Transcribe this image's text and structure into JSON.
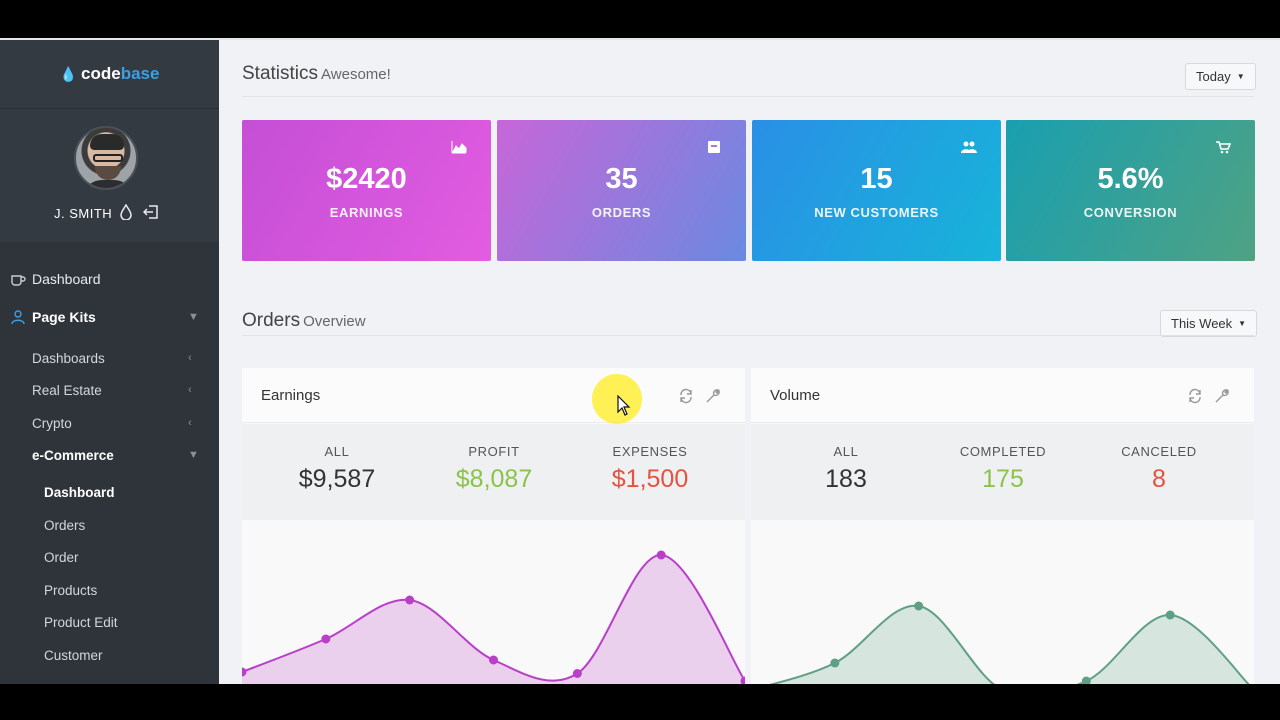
{
  "brand": {
    "part1": "code",
    "part2": "base"
  },
  "user": {
    "name": "J. SMITH"
  },
  "nav": {
    "dashboard": "Dashboard",
    "page_kits": "Page Kits",
    "dashboards": "Dashboards",
    "real_estate": "Real Estate",
    "crypto": "Crypto",
    "ecommerce": "e-Commerce",
    "ec_items": [
      "Dashboard",
      "Orders",
      "Order",
      "Products",
      "Product Edit",
      "Customer"
    ]
  },
  "statistics": {
    "title": "Statistics",
    "subtitle": "Awesome!",
    "range": "Today",
    "cards": [
      {
        "value": "$2420",
        "label": "EARNINGS",
        "icon": "area-chart-icon"
      },
      {
        "value": "35",
        "label": "ORDERS",
        "icon": "inbox-icon"
      },
      {
        "value": "15",
        "label": "NEW CUSTOMERS",
        "icon": "users-icon"
      },
      {
        "value": "5.6%",
        "label": "CONVERSION",
        "icon": "cart-icon"
      }
    ]
  },
  "orders": {
    "title": "Orders",
    "subtitle": "Overview",
    "range": "This Week"
  },
  "earnings": {
    "title": "Earnings",
    "kpis": [
      {
        "label": "ALL",
        "value": "$9,587"
      },
      {
        "label": "PROFIT",
        "value": "$8,087"
      },
      {
        "label": "EXPENSES",
        "value": "$1,500"
      }
    ],
    "chart_color": "#b93fc9",
    "points": [
      0.12,
      0.34,
      0.6,
      0.2,
      0.11,
      0.9,
      0.06
    ]
  },
  "volume": {
    "title": "Volume",
    "kpis": [
      {
        "label": "ALL",
        "value": "183"
      },
      {
        "label": "COMPLETED",
        "value": "175"
      },
      {
        "label": "CANCELED",
        "value": "8"
      }
    ],
    "chart_color": "#5fa085",
    "points": [
      0.0,
      0.18,
      0.56,
      0.0,
      0.06,
      0.5,
      0.0
    ]
  }
}
